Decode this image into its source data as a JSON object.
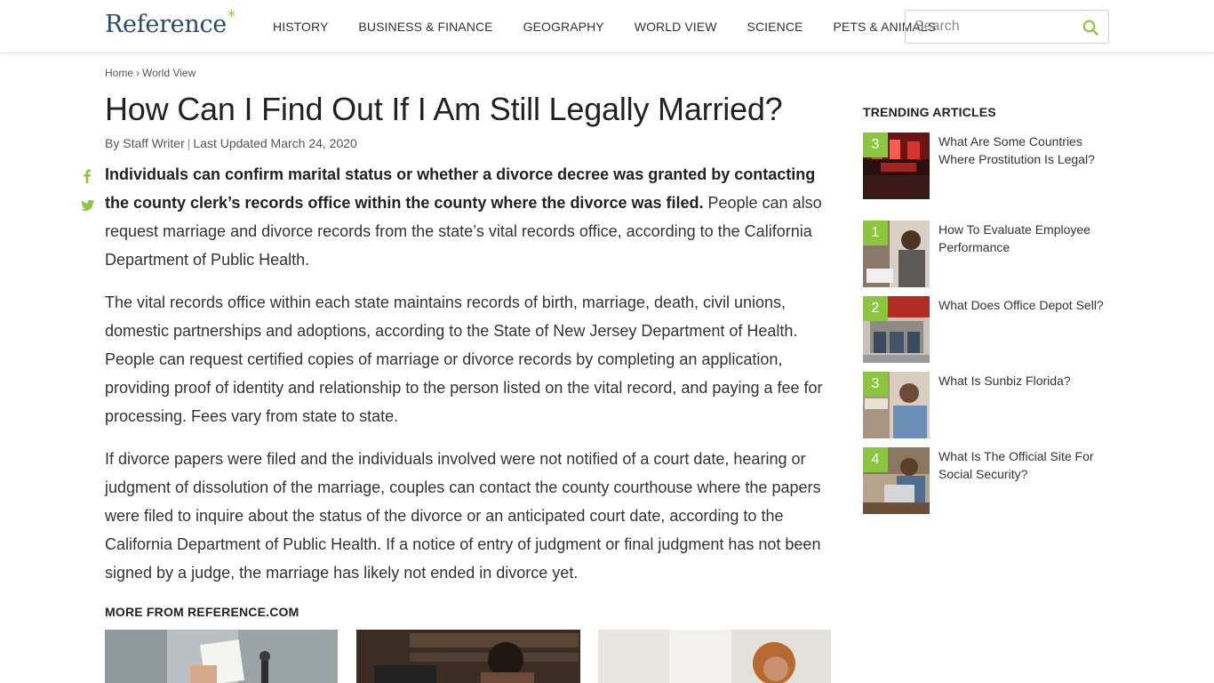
{
  "header": {
    "logo_text": "Reference",
    "logo_star": "*",
    "nav": [
      "HISTORY",
      "BUSINESS & FINANCE",
      "GEOGRAPHY",
      "WORLD VIEW",
      "SCIENCE",
      "PETS & ANIMALS"
    ],
    "search_placeholder": "Search",
    "search_icon": "search-icon"
  },
  "breadcrumb": {
    "home": "Home",
    "separator": "›",
    "current": "World View"
  },
  "article": {
    "title": "How Can I Find Out If I Am Still Legally Married?",
    "byline_author": "By Staff Writer",
    "byline_separator": "|",
    "byline_updated": "Last Updated March 24, 2020",
    "lead_bold": "Individuals can confirm marital status or whether a divorce decree was granted by contacting the county clerk’s records office within the county where the divorce was filed.",
    "lead_rest": " People can also request marriage and divorce records from the state’s vital records office, according to the California Department of Public Health.",
    "paragraph_2": "The vital records office within each state maintains records of birth, marriage, death, civil unions, domestic partnerships and adoptions, according to the State of New Jersey Department of Health. People can request certified copies of marriage or divorce records by completing an application, providing proof of identity and relationship to the person listed on the vital record, and paying a fee for processing. Fees vary from state to state.",
    "paragraph_3": "If divorce papers were filed and the individuals involved were not notified of a court date, hearing or judgment of dissolution of the marriage, couples can contact the county courthouse where the papers were filed to inquire about the status of the divorce or an anticipated court date, according to the California Department of Public Health. If a notice of entry of judgment or final judgment has not been signed by a judge, the marriage has likely not ended in divorce yet."
  },
  "social": {
    "facebook_icon": "facebook-icon",
    "twitter_icon": "twitter-icon"
  },
  "more_from": {
    "heading": "MORE FROM REFERENCE.COM"
  },
  "trending": {
    "heading": "TRENDING ARTICLES",
    "items": [
      {
        "num": "3",
        "title": "What Are Some Countries Where Prostitution Is Legal?"
      },
      {
        "num": "1",
        "title": "How To Evaluate Employee Performance"
      },
      {
        "num": "2",
        "title": "What Does Office Depot Sell?"
      },
      {
        "num": "3",
        "title": "What Is Sunbiz Florida?"
      },
      {
        "num": "4",
        "title": "What Is The Official Site For Social Security?"
      }
    ]
  },
  "colors": {
    "accent": "#8cc63e",
    "logo": "#2a4a6b",
    "text": "#333333"
  }
}
